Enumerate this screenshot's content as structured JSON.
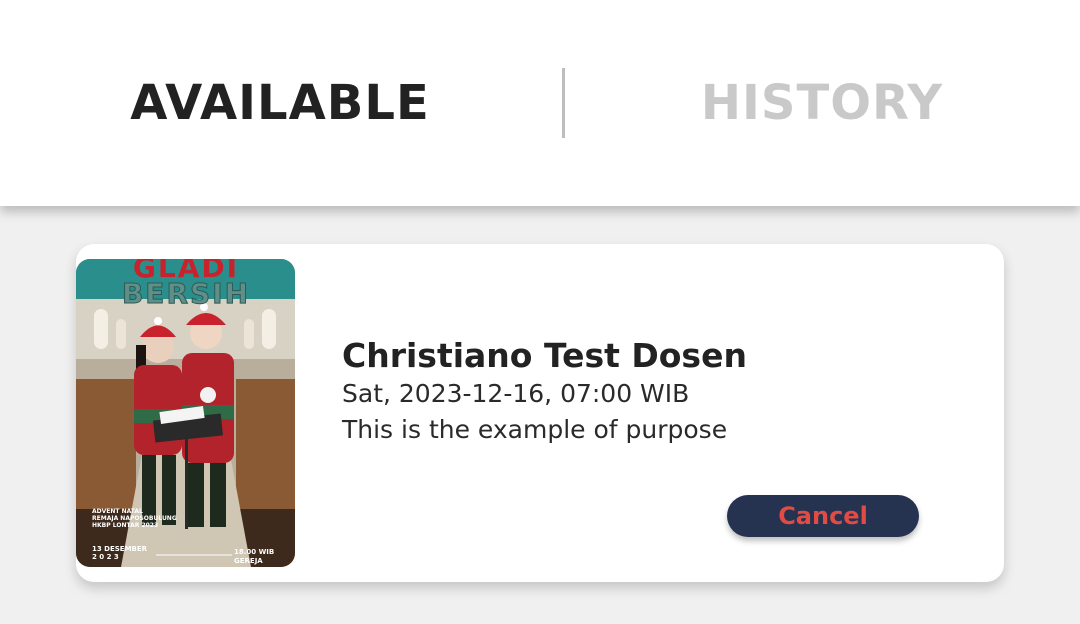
{
  "tabs": {
    "available_label": "AVAILABLE",
    "history_label": "HISTORY"
  },
  "booking": {
    "name": "Christiano Test Dosen",
    "datetime": "Sat, 2023-12-16, 07:00 WIB",
    "purpose": "This is the example of purpose",
    "cancel_label": "Cancel"
  },
  "poster": {
    "heading_top": "GLADI",
    "heading_bottom": "BERSIH",
    "event_line1": "ADVENT NATAL",
    "event_line2": "REMAJA NAPOSOBULUNG",
    "event_line3": "HKBP LONTAR 2023",
    "date": "13 DESEMBER",
    "year": "2 0 2 3",
    "time": "18.00 WIB",
    "place": "GEREJA"
  },
  "colors": {
    "active_tab": "#222222",
    "inactive_tab": "#c9c9c9",
    "cancel_bg": "#253350",
    "cancel_text": "#e14b44"
  }
}
